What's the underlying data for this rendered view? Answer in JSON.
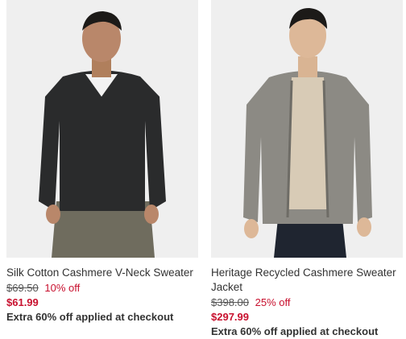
{
  "products": [
    {
      "image_alt": "model-black-vneck-sweater",
      "name": "Silk Cotton Cashmere V-Neck Sweater",
      "original_price": "$69.50",
      "discount": "10% off",
      "sale_price": "$61.99",
      "promo": "Extra 60% off applied at checkout",
      "colors": {
        "garment": "#2a2b2c",
        "pants": "#6f6c5e",
        "undershirt": "#f2f2f2"
      }
    },
    {
      "image_alt": "model-gray-zip-jacket",
      "name": "Heritage Recycled Cashmere Sweater Jacket",
      "original_price": "$398.00",
      "discount": "25% off",
      "sale_price": "$297.99",
      "promo": "Extra 60% off applied at checkout",
      "colors": {
        "garment": "#8c8a84",
        "pants": "#1f2530",
        "undershirt": "#d8cbb6"
      }
    }
  ],
  "theme": {
    "sale_red": "#c8102e",
    "text": "#333333",
    "image_bg": "#efefef"
  }
}
